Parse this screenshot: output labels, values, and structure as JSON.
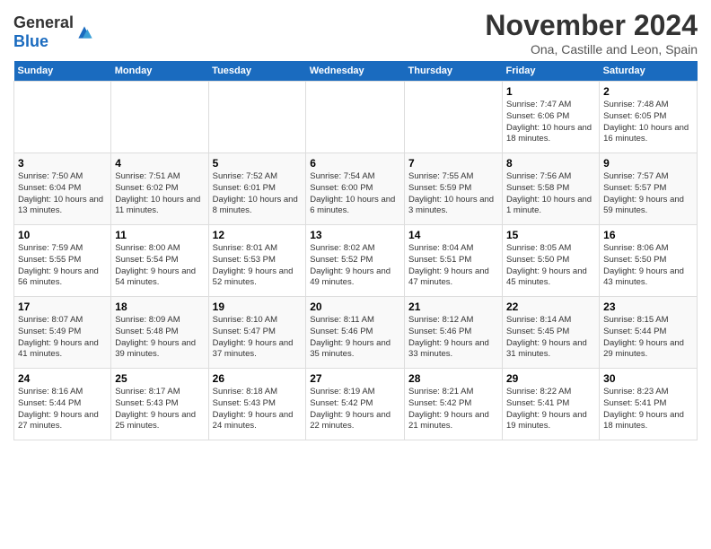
{
  "header": {
    "logo_general": "General",
    "logo_blue": "Blue",
    "title": "November 2024",
    "location": "Ona, Castille and Leon, Spain"
  },
  "days_of_week": [
    "Sunday",
    "Monday",
    "Tuesday",
    "Wednesday",
    "Thursday",
    "Friday",
    "Saturday"
  ],
  "weeks": [
    {
      "days": [
        {
          "number": "",
          "info": ""
        },
        {
          "number": "",
          "info": ""
        },
        {
          "number": "",
          "info": ""
        },
        {
          "number": "",
          "info": ""
        },
        {
          "number": "",
          "info": ""
        },
        {
          "number": "1",
          "info": "Sunrise: 7:47 AM\nSunset: 6:06 PM\nDaylight: 10 hours and 18 minutes."
        },
        {
          "number": "2",
          "info": "Sunrise: 7:48 AM\nSunset: 6:05 PM\nDaylight: 10 hours and 16 minutes."
        }
      ]
    },
    {
      "days": [
        {
          "number": "3",
          "info": "Sunrise: 7:50 AM\nSunset: 6:04 PM\nDaylight: 10 hours and 13 minutes."
        },
        {
          "number": "4",
          "info": "Sunrise: 7:51 AM\nSunset: 6:02 PM\nDaylight: 10 hours and 11 minutes."
        },
        {
          "number": "5",
          "info": "Sunrise: 7:52 AM\nSunset: 6:01 PM\nDaylight: 10 hours and 8 minutes."
        },
        {
          "number": "6",
          "info": "Sunrise: 7:54 AM\nSunset: 6:00 PM\nDaylight: 10 hours and 6 minutes."
        },
        {
          "number": "7",
          "info": "Sunrise: 7:55 AM\nSunset: 5:59 PM\nDaylight: 10 hours and 3 minutes."
        },
        {
          "number": "8",
          "info": "Sunrise: 7:56 AM\nSunset: 5:58 PM\nDaylight: 10 hours and 1 minute."
        },
        {
          "number": "9",
          "info": "Sunrise: 7:57 AM\nSunset: 5:57 PM\nDaylight: 9 hours and 59 minutes."
        }
      ]
    },
    {
      "days": [
        {
          "number": "10",
          "info": "Sunrise: 7:59 AM\nSunset: 5:55 PM\nDaylight: 9 hours and 56 minutes."
        },
        {
          "number": "11",
          "info": "Sunrise: 8:00 AM\nSunset: 5:54 PM\nDaylight: 9 hours and 54 minutes."
        },
        {
          "number": "12",
          "info": "Sunrise: 8:01 AM\nSunset: 5:53 PM\nDaylight: 9 hours and 52 minutes."
        },
        {
          "number": "13",
          "info": "Sunrise: 8:02 AM\nSunset: 5:52 PM\nDaylight: 9 hours and 49 minutes."
        },
        {
          "number": "14",
          "info": "Sunrise: 8:04 AM\nSunset: 5:51 PM\nDaylight: 9 hours and 47 minutes."
        },
        {
          "number": "15",
          "info": "Sunrise: 8:05 AM\nSunset: 5:50 PM\nDaylight: 9 hours and 45 minutes."
        },
        {
          "number": "16",
          "info": "Sunrise: 8:06 AM\nSunset: 5:50 PM\nDaylight: 9 hours and 43 minutes."
        }
      ]
    },
    {
      "days": [
        {
          "number": "17",
          "info": "Sunrise: 8:07 AM\nSunset: 5:49 PM\nDaylight: 9 hours and 41 minutes."
        },
        {
          "number": "18",
          "info": "Sunrise: 8:09 AM\nSunset: 5:48 PM\nDaylight: 9 hours and 39 minutes."
        },
        {
          "number": "19",
          "info": "Sunrise: 8:10 AM\nSunset: 5:47 PM\nDaylight: 9 hours and 37 minutes."
        },
        {
          "number": "20",
          "info": "Sunrise: 8:11 AM\nSunset: 5:46 PM\nDaylight: 9 hours and 35 minutes."
        },
        {
          "number": "21",
          "info": "Sunrise: 8:12 AM\nSunset: 5:46 PM\nDaylight: 9 hours and 33 minutes."
        },
        {
          "number": "22",
          "info": "Sunrise: 8:14 AM\nSunset: 5:45 PM\nDaylight: 9 hours and 31 minutes."
        },
        {
          "number": "23",
          "info": "Sunrise: 8:15 AM\nSunset: 5:44 PM\nDaylight: 9 hours and 29 minutes."
        }
      ]
    },
    {
      "days": [
        {
          "number": "24",
          "info": "Sunrise: 8:16 AM\nSunset: 5:44 PM\nDaylight: 9 hours and 27 minutes."
        },
        {
          "number": "25",
          "info": "Sunrise: 8:17 AM\nSunset: 5:43 PM\nDaylight: 9 hours and 25 minutes."
        },
        {
          "number": "26",
          "info": "Sunrise: 8:18 AM\nSunset: 5:43 PM\nDaylight: 9 hours and 24 minutes."
        },
        {
          "number": "27",
          "info": "Sunrise: 8:19 AM\nSunset: 5:42 PM\nDaylight: 9 hours and 22 minutes."
        },
        {
          "number": "28",
          "info": "Sunrise: 8:21 AM\nSunset: 5:42 PM\nDaylight: 9 hours and 21 minutes."
        },
        {
          "number": "29",
          "info": "Sunrise: 8:22 AM\nSunset: 5:41 PM\nDaylight: 9 hours and 19 minutes."
        },
        {
          "number": "30",
          "info": "Sunrise: 8:23 AM\nSunset: 5:41 PM\nDaylight: 9 hours and 18 minutes."
        }
      ]
    }
  ]
}
